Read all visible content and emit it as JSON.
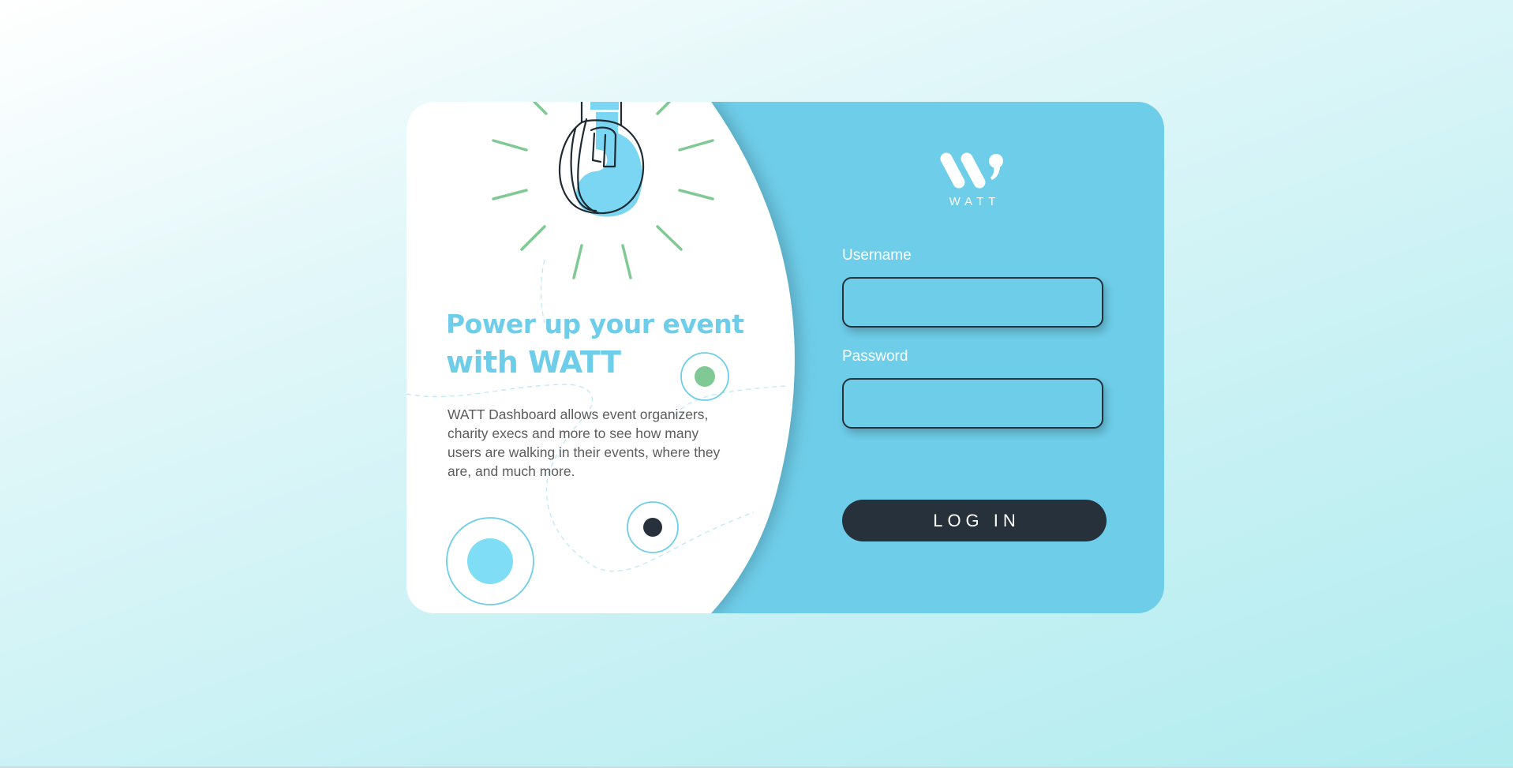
{
  "hero": {
    "headline_line1": "Power up your event",
    "headline_line2_prefix": "with ",
    "headline_line2_brand": "WATT",
    "description": "WATT Dashboard allows event organizers, charity execs and more to see how many users are walking in their events, where they are, and much more."
  },
  "logo": {
    "text": "WATT"
  },
  "form": {
    "username_label": "Username",
    "username_value": "",
    "password_label": "Password",
    "password_value": "",
    "login_label": "LOG IN"
  },
  "colors": {
    "page_background": "#c8f1f4",
    "panel_accent": "#6ecde9",
    "ray_green": "#80c994",
    "button_dark": "#26313b",
    "text_gray": "#5c5c5c"
  },
  "icons": {
    "illustration": "lightbulb-icon",
    "logo": "watt-logo-icon"
  }
}
